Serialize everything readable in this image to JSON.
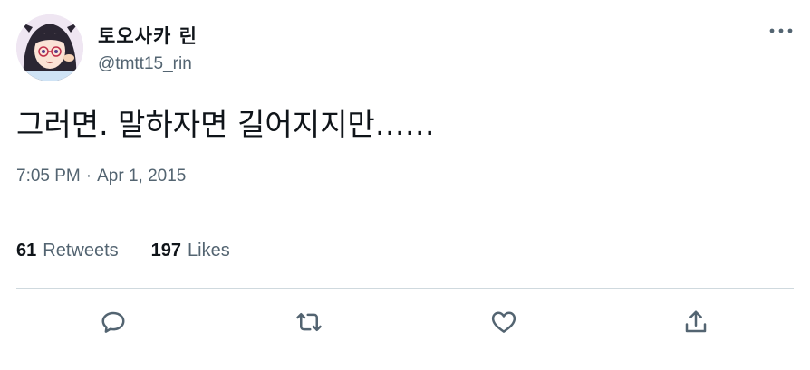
{
  "author": {
    "display_name": "토오사카 린",
    "handle": "@tmtt15_rin",
    "avatar_icon": "avatar-anime-girl"
  },
  "tweet": {
    "text": "그러면. 말하자면 길어지지만……",
    "time": "7:05 PM",
    "separator": "·",
    "date": "Apr 1, 2015"
  },
  "stats": {
    "retweets_count": "61",
    "retweets_label": "Retweets",
    "likes_count": "197",
    "likes_label": "Likes"
  },
  "actions": {
    "reply_icon": "reply-icon",
    "retweet_icon": "retweet-icon",
    "like_icon": "heart-icon",
    "share_icon": "share-icon"
  },
  "colors": {
    "text_primary": "#0f1419",
    "text_secondary": "#536471",
    "divider": "#cfd9de"
  }
}
